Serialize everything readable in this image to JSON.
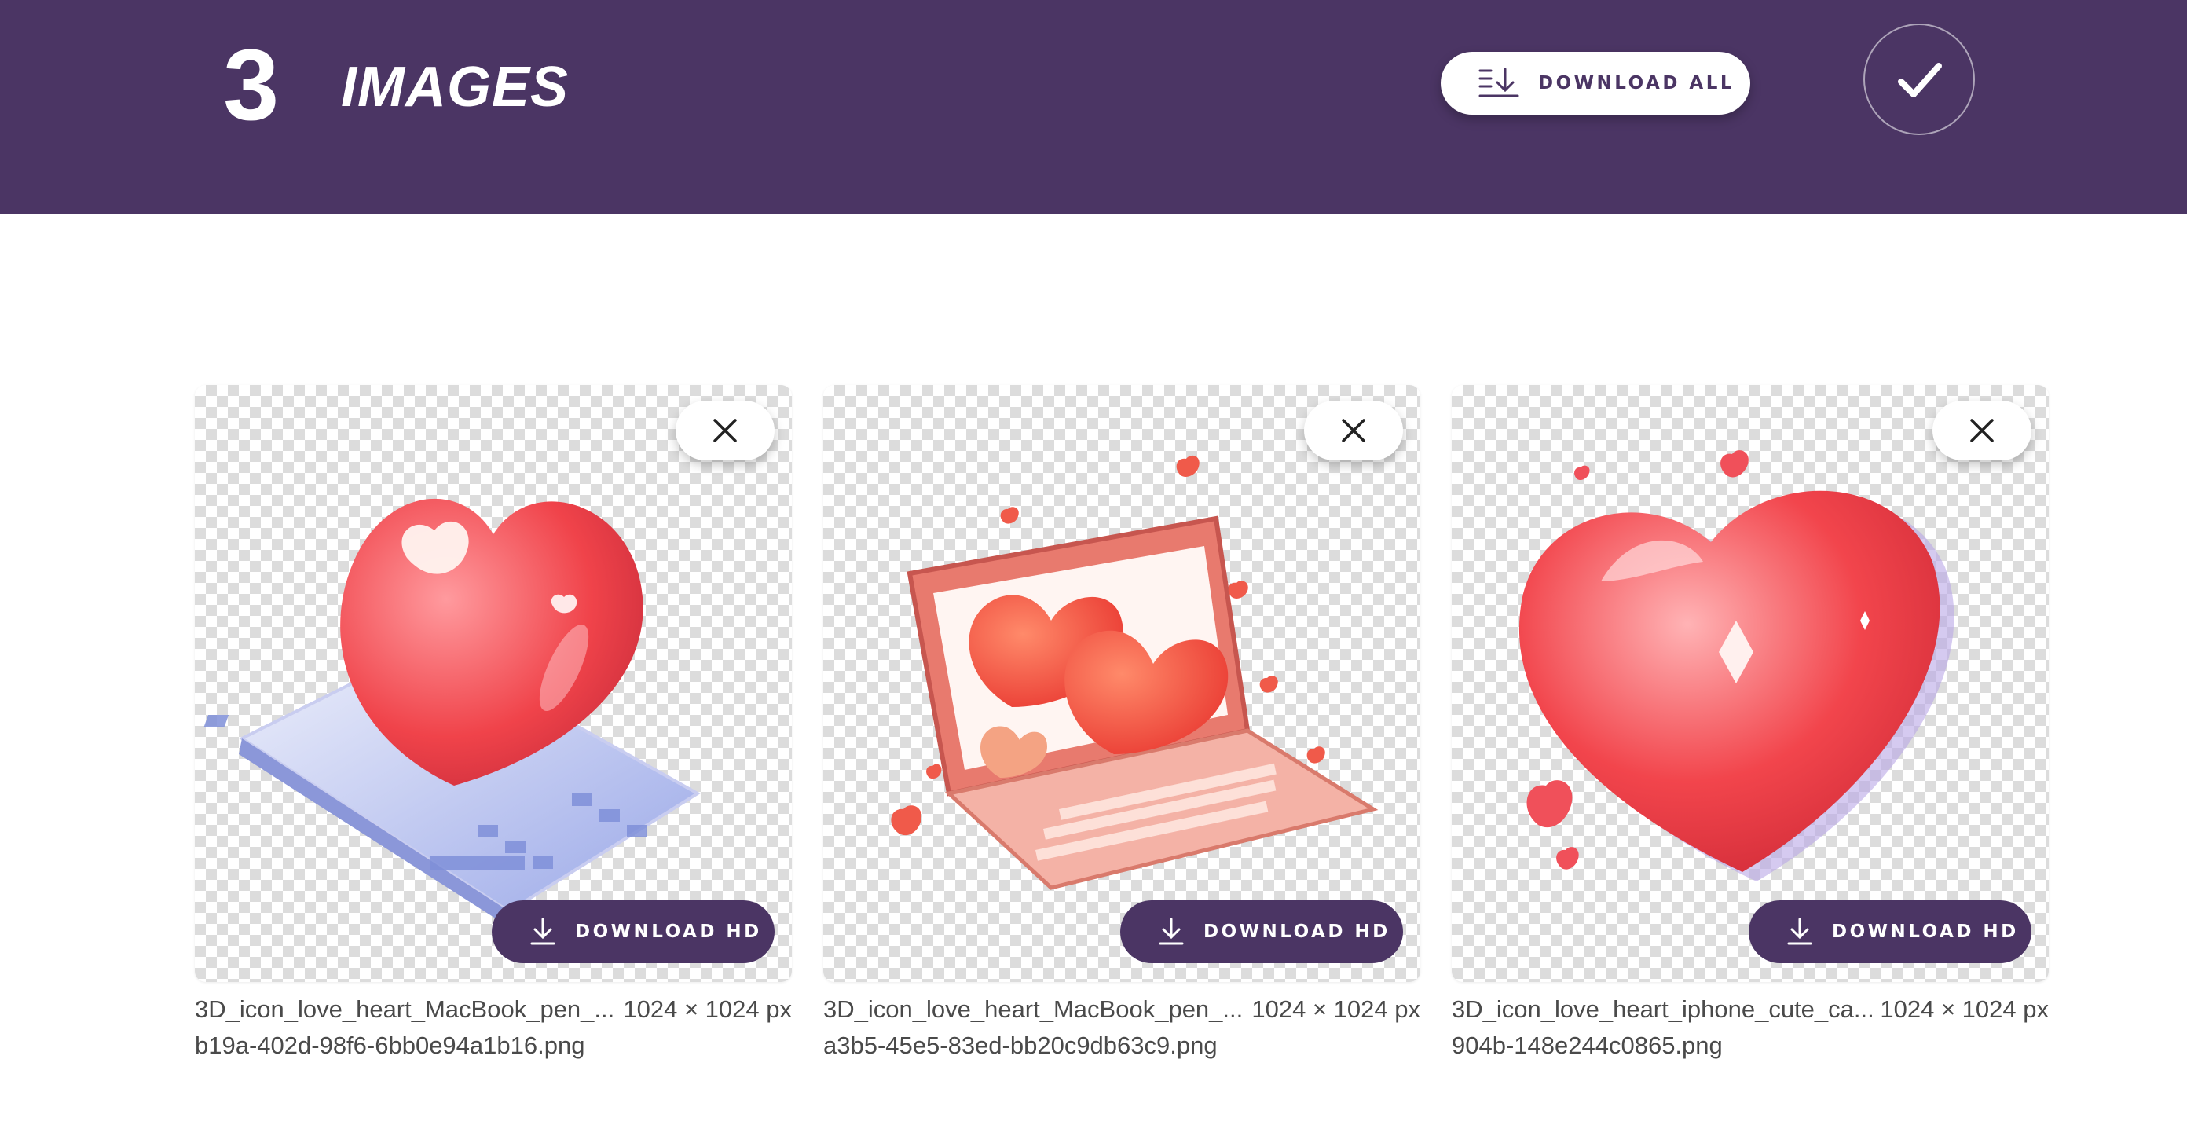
{
  "header": {
    "count": "3",
    "title": "IMAGES",
    "download_all_label": "DOWNLOAD ALL",
    "download_all_icon": "sort-download-icon",
    "confirm_icon": "checkmark-icon",
    "background_color": "#4b3564"
  },
  "images": [
    {
      "name_line1": "3D_icon_love_heart_MacBook_pen_...",
      "dimensions": "1024 × 1024 px",
      "name_line2": "b19a-402d-98f6-6bb0e94a1b16.png",
      "download_label": "DOWNLOAD HD",
      "close_icon": "close-icon",
      "download_icon": "download-icon",
      "subject": "glossy red heart on laptop keyboard"
    },
    {
      "name_line1": "3D_icon_love_heart_MacBook_pen_...",
      "dimensions": "1024 × 1024 px",
      "name_line2": "a3b5-45e5-83ed-bb20c9db63c9.png",
      "download_label": "DOWNLOAD HD",
      "close_icon": "close-icon",
      "download_icon": "download-icon",
      "subject": "laptop with hearts on screen"
    },
    {
      "name_line1": "3D_icon_love_heart_iphone_cute_ca...",
      "dimensions": "1024 × 1024 px",
      "name_line2": "904b-148e244c0865.png",
      "download_label": "DOWNLOAD HD",
      "close_icon": "close-icon",
      "download_icon": "download-icon",
      "subject": "large glossy red heart with small hearts"
    }
  ],
  "colors": {
    "accent": "#4b3564",
    "heart_red": "#f0434a",
    "heart_pink": "#f98a8f"
  }
}
